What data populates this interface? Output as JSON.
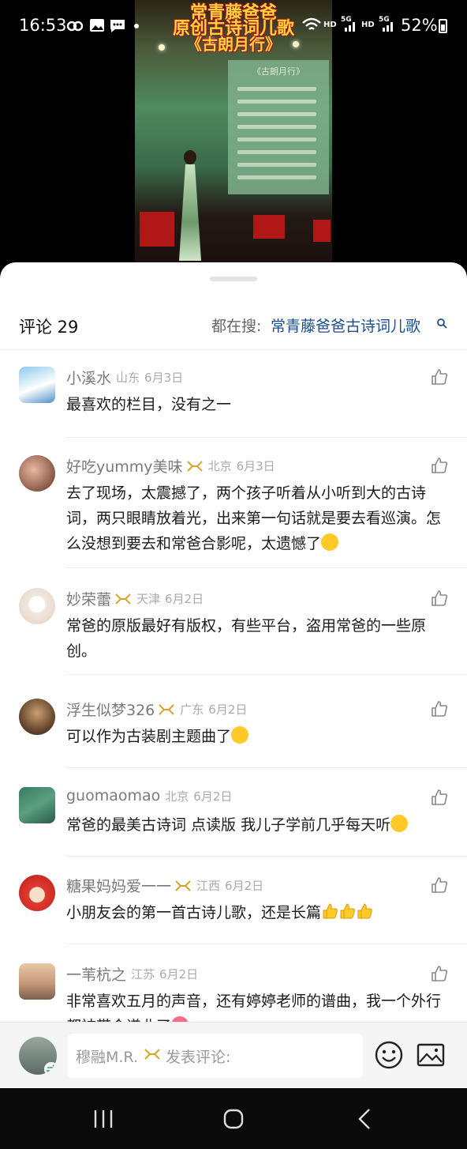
{
  "status_bar": {
    "time": "16:53",
    "network_label_1": "HD",
    "network_label_2": "5G",
    "network_label_3": "HD",
    "network_label_4": "5G",
    "battery": "52%",
    "icons": [
      "baidu-netdisk-icon",
      "gallery-icon",
      "message-icon",
      "notification-dot-icon",
      "wifi-icon",
      "signal-icon",
      "signal-icon",
      "battery-icon"
    ]
  },
  "video": {
    "caption_line_1": "常青藤爸爸",
    "caption_line_2": "原创古诗词儿歌",
    "caption_line_3": "《古朗月行》",
    "screen_title": "《古朗月行》"
  },
  "comments_sheet": {
    "title": "评论 29",
    "trending_label": "都在搜:",
    "trending_query": "常青藤爸爸古诗词儿歌",
    "search_icon": "search-icon"
  },
  "comments": [
    {
      "user": "小溪水",
      "badge": false,
      "region": "山东",
      "date": "6月3日",
      "text": "最喜欢的栏目，没有之一",
      "emoji": []
    },
    {
      "user": "好吃yummy美味",
      "badge": true,
      "region": "北京",
      "date": "6月3日",
      "text": "去了现场，太震撼了，两个孩子听着从小听到大的古诗词，两只眼睛放着光，出来第一句话就是要去看巡演。怎么没想到要去和常爸合影呢，太遗憾了",
      "emoji": [
        "laughing-crying-emoji"
      ]
    },
    {
      "user": "妙荣蕾",
      "badge": true,
      "region": "天津",
      "date": "6月2日",
      "text": "常爸的原版最好有版权，有些平台，盗用常爸的一些原创。",
      "emoji": []
    },
    {
      "user": "浮生似梦326",
      "badge": true,
      "region": "广东",
      "date": "6月2日",
      "text": "可以作为古装剧主题曲了",
      "emoji": [
        "smiling-emoji"
      ]
    },
    {
      "user": "guomaomao",
      "badge": false,
      "region": "北京",
      "date": "6月2日",
      "text": "常爸的最美古诗词 点读版 我儿子学前几乎每天听",
      "emoji": [
        "grinning-emoji"
      ]
    },
    {
      "user": "糖果妈妈爱一一",
      "badge": true,
      "region": "江西",
      "date": "6月2日",
      "text": "小朋友会的第一首古诗儿歌，还是长篇",
      "emoji": [
        "thumbs-up-emoji",
        "thumbs-up-emoji",
        "thumbs-up-emoji"
      ]
    },
    {
      "user": "一苇杭之",
      "badge": false,
      "region": "江苏",
      "date": "6月2日",
      "text": "非常喜欢五月的声音，还有婷婷老师的谱曲，我一个外行都被带会谱曲了",
      "emoji": [
        "heart-emoji"
      ]
    }
  ],
  "composer": {
    "user_name": "穆融M.R.",
    "placeholder": "发表评论:",
    "emoji_button_icon": "emoji-icon",
    "image_button_icon": "image-icon"
  },
  "navbar": {
    "icons": [
      "recents-icon",
      "home-icon",
      "back-icon"
    ]
  },
  "colors": {
    "link": "#1a4e8f",
    "meta_text": "#aaaaaa",
    "username": "#7a7a7a",
    "badge_gold": "#d4a52a",
    "caption_yellow": "#ffd23a"
  }
}
